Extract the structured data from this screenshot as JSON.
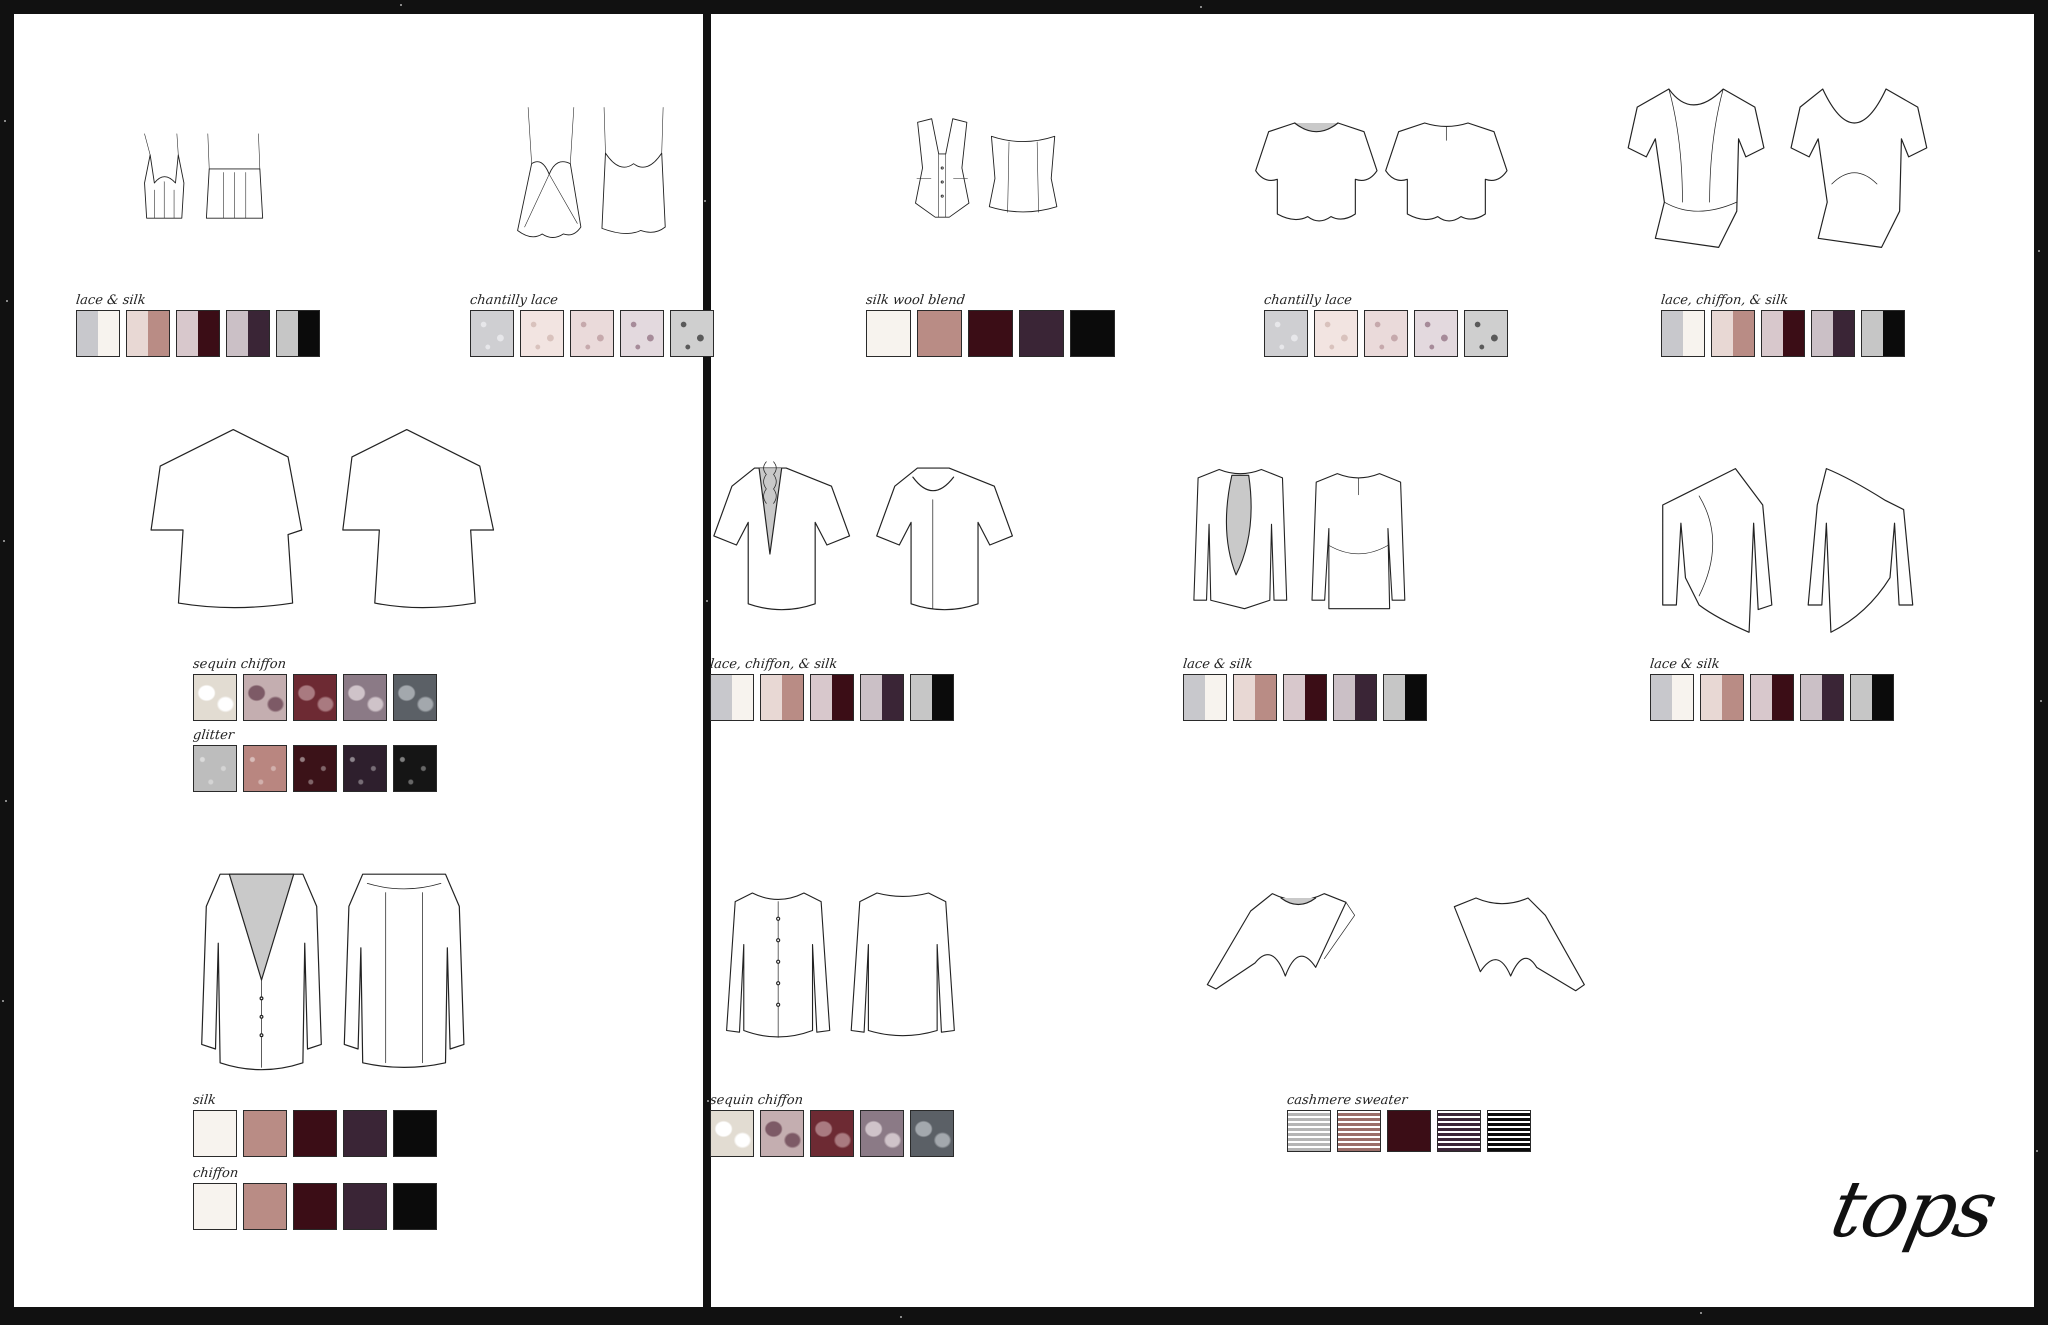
{
  "title": "tops",
  "colors": {
    "ivory": "#f7f3ee",
    "blush": "#b98c85",
    "wine": "#3b0d16",
    "plum": "#3a2536",
    "black": "#0b0b0b",
    "lace_grey": "#c8c8cc",
    "glitter_silver": "#bdbdbd"
  },
  "sections": [
    {
      "label": "lace & silk"
    },
    {
      "label": "chantilly lace"
    },
    {
      "label": "silk wool blend"
    },
    {
      "label": "chantilly lace"
    },
    {
      "label": "lace, chiffon, & silk"
    },
    {
      "label": "sequin chiffon",
      "label2": "glitter"
    },
    {
      "label": "lace, chiffon, & silk"
    },
    {
      "label": "lace & silk"
    },
    {
      "label": "lace & silk"
    },
    {
      "label": "silk",
      "label2": "chiffon"
    },
    {
      "label": "sequin chiffon"
    },
    {
      "label": "cashmere sweater"
    }
  ],
  "garments": [
    {
      "icon": "bustier-top-icon"
    },
    {
      "icon": "lace-camisole-icon"
    },
    {
      "icon": "corset-vest-icon"
    },
    {
      "icon": "cropped-tee-icon"
    },
    {
      "icon": "wrap-bodysuit-icon"
    },
    {
      "icon": "off-shoulder-tee-icon"
    },
    {
      "icon": "ruffle-neck-top-icon"
    },
    {
      "icon": "cutout-jacket-icon"
    },
    {
      "icon": "draped-cardigan-icon"
    },
    {
      "icon": "v-back-shirt-icon"
    },
    {
      "icon": "button-blouse-icon"
    },
    {
      "icon": "cropped-shrug-icon"
    }
  ]
}
